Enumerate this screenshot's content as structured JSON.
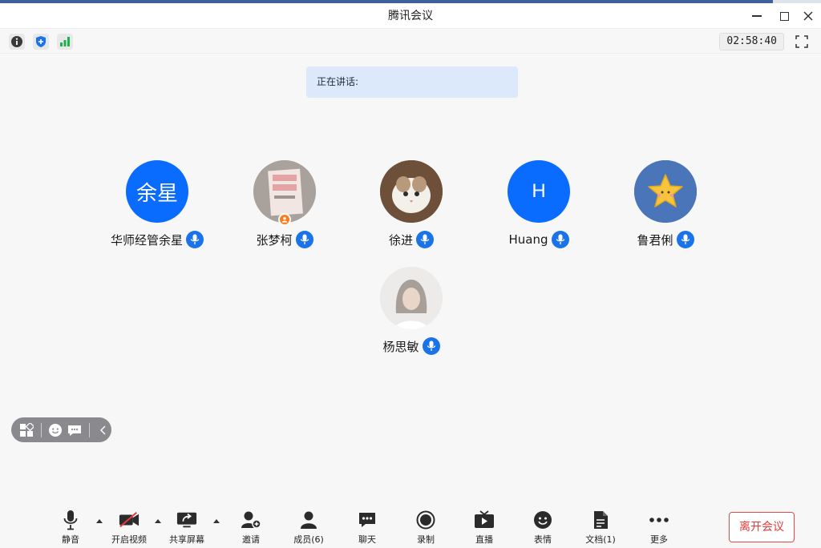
{
  "window": {
    "title": "腾讯会议"
  },
  "toolbar": {
    "timer": "02:58:40"
  },
  "speaking": {
    "label": "正在讲话:"
  },
  "participants": [
    {
      "name": "华师经管余星",
      "avatar_text": "余星",
      "avatar_color": "#0a6cff"
    },
    {
      "name": "张梦柯",
      "avatar_text": ""
    },
    {
      "name": "徐进",
      "avatar_text": ""
    },
    {
      "name": "Huang",
      "avatar_text": "H",
      "avatar_color": "#0a6cff"
    },
    {
      "name": "鲁君俐",
      "avatar_text": ""
    },
    {
      "name": "杨思敏",
      "avatar_text": ""
    }
  ],
  "bottom": {
    "mute": "静音",
    "video": "开启视频",
    "share": "共享屏幕",
    "invite": "邀请",
    "members": "成员(6)",
    "chat": "聊天",
    "record": "录制",
    "live": "直播",
    "emoji": "表情",
    "docs": "文档(1)",
    "more": "更多",
    "leave": "离开会议"
  },
  "colors": {
    "accent": "#1a73e8",
    "leave": "#e23b3b",
    "host_badge": "#ff7a1a"
  }
}
